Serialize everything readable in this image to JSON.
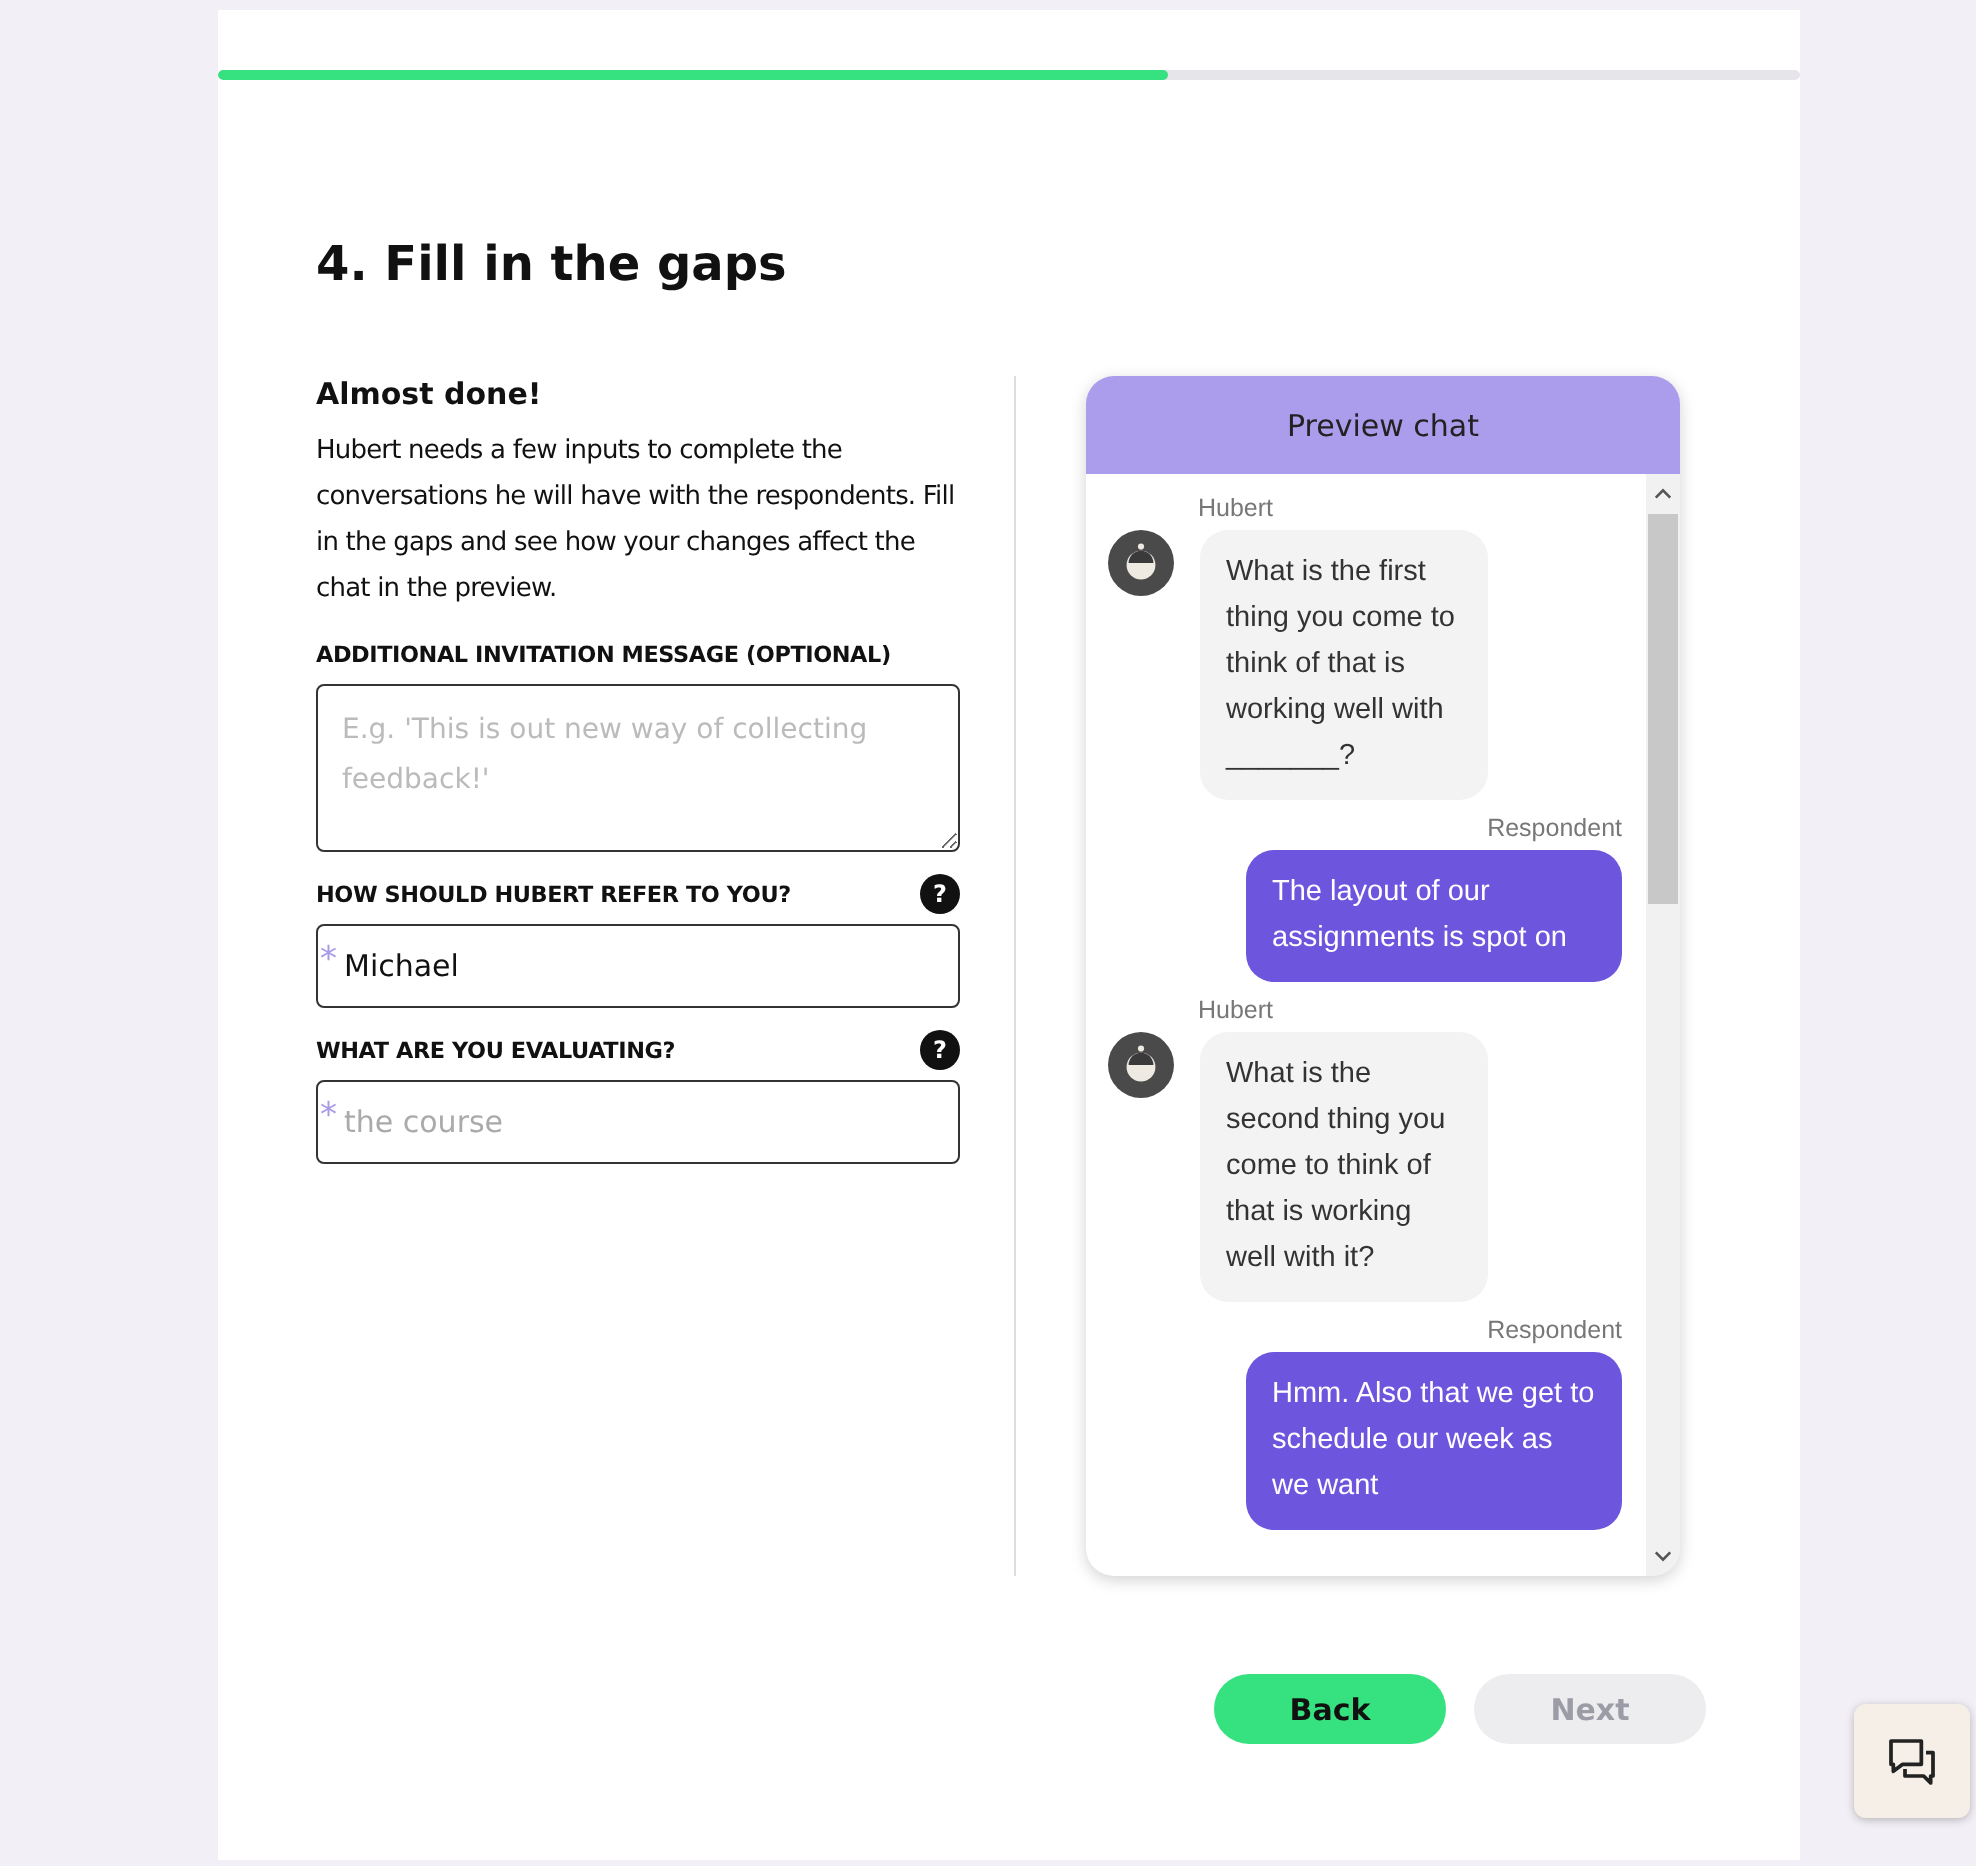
{
  "progress": {
    "level": 0.6
  },
  "title": "4. Fill in the gaps",
  "intro": {
    "heading": "Almost done!",
    "text": "Hubert needs a few inputs to complete the conversations he will have with the respondents. Fill in the gaps and see how your changes affect the chat in the preview."
  },
  "fields": [
    {
      "kind": "textarea",
      "label": "ADDITIONAL INVITATION MESSAGE (OPTIONAL)",
      "placeholder": "E.g. 'This is out new way of collecting feedback!'"
    },
    {
      "kind": "input",
      "label": "HOW SHOULD HUBERT REFER TO YOU?",
      "value": "Michael",
      "required_mark": "*",
      "help_text": "?"
    },
    {
      "kind": "input",
      "label": "WHAT ARE YOU EVALUATING?",
      "placeholder": "the course",
      "required_mark": "*",
      "help_text": "?"
    }
  ],
  "chat": {
    "title": "Preview chat",
    "messages": [
      {
        "sender": "Hubert",
        "kind": "bot",
        "text": "What is the first thing you come to think of that is working well with _______?"
      },
      {
        "sender": "Respondent",
        "kind": "user",
        "text": "The layout of our assignments is spot on"
      },
      {
        "sender": "Hubert",
        "kind": "bot",
        "text": "What is the second thing you come to think of that is working well with it?"
      },
      {
        "sender": "Respondent",
        "kind": "user",
        "text": "Hmm. Also that we get to schedule our week as we want"
      }
    ]
  },
  "buttons": [
    {
      "label": "Back",
      "disabled": false
    },
    {
      "label": "Next",
      "disabled": true
    }
  ]
}
